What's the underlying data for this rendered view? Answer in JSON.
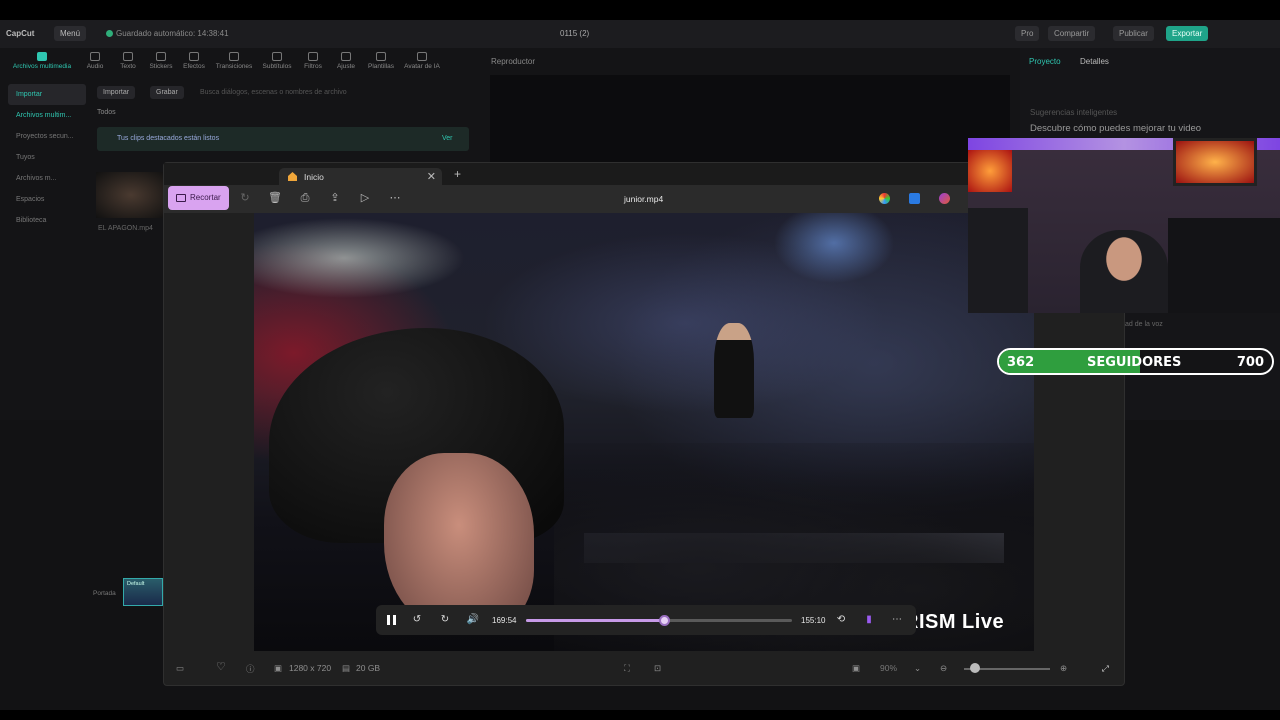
{
  "capcut": {
    "logo": "CapCut",
    "menu": "Menú",
    "autosave": "Guardado automático: 14:38:41",
    "project_name": "0115 (2)",
    "pro": "Pro",
    "share": "Compartir",
    "publish": "Publicar",
    "export": "Exportar",
    "tools": [
      "Archivos multimedia",
      "Audio",
      "Texto",
      "Stickers",
      "Efectos",
      "Transiciones",
      "Subtítulos",
      "Filtros",
      "Ajuste",
      "Plantillas",
      "Avatar de IA"
    ],
    "left_items": [
      "Importar",
      "Archivos multim...",
      "Proyectos secun...",
      "Tuyos",
      "Archivos m...",
      "Espacios",
      "Biblioteca"
    ],
    "import_btn": "Importar",
    "record_btn": "Grabar",
    "search_placeholder": "Busca diálogos, escenas o nombres de archivo",
    "filter_all": "Todos",
    "notice": "Tus clips destacados están listos",
    "notice_link": "Ver",
    "clip_name": "EL APAGON.mp4",
    "player_title": "Reproductor",
    "right_tabs": [
      "Proyecto",
      "Detalles"
    ],
    "suggestions": "Sugerencias inteligentes",
    "suggestions_sub": "Descubre cómo puedes mejorar tu video",
    "voice": "ad de la voz",
    "cover": "Portada",
    "track_label": "Default"
  },
  "viewer": {
    "tab_label": "Inicio",
    "crop_label": "Recortar",
    "filename": "junior.mp4",
    "time_current": "169:54",
    "time_total": "155:10",
    "progress": 0.52,
    "resolution": "1280 x 720",
    "size": "20 GB",
    "zoom": "90%",
    "watermark": "RISM Live"
  },
  "overlay": {
    "followers_current": "362",
    "followers_label": "SEGUIDORES",
    "followers_goal": "700",
    "followers_progress": 0.517
  }
}
